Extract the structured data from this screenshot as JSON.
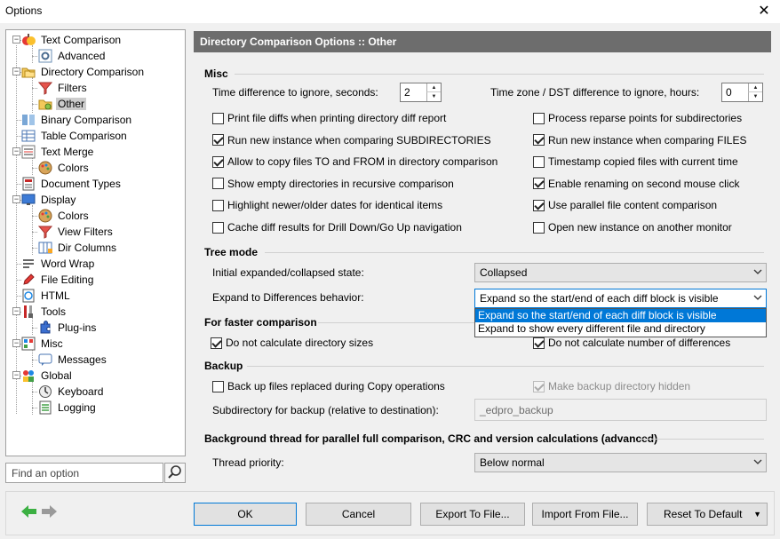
{
  "window": {
    "title": "Options",
    "close": "✕"
  },
  "tree": {
    "items": [
      {
        "label": "Text Comparison",
        "icon": "apple-text-comparison-icon"
      },
      {
        "label": "Advanced",
        "icon": "advanced-settings-icon"
      },
      {
        "label": "Directory Comparison",
        "icon": "folder-comparison-icon"
      },
      {
        "label": "Filters",
        "icon": "funnel-filter-icon"
      },
      {
        "label": "Other",
        "icon": "folder-gear-icon"
      },
      {
        "label": "Binary Comparison",
        "icon": "binary-comparison-icon"
      },
      {
        "label": "Table Comparison",
        "icon": "table-icon"
      },
      {
        "label": "Text Merge",
        "icon": "merge-icon"
      },
      {
        "label": "Colors",
        "icon": "palette-icon"
      },
      {
        "label": "Document Types",
        "icon": "document-types-icon"
      },
      {
        "label": "Display",
        "icon": "monitor-icon"
      },
      {
        "label": "Colors",
        "icon": "palette-icon"
      },
      {
        "label": "View Filters",
        "icon": "funnel-filter-icon"
      },
      {
        "label": "Dir Columns",
        "icon": "columns-icon"
      },
      {
        "label": "Word Wrap",
        "icon": "word-wrap-icon"
      },
      {
        "label": "File Editing",
        "icon": "pencil-icon"
      },
      {
        "label": "HTML",
        "icon": "html-icon"
      },
      {
        "label": "Tools",
        "icon": "tools-icon"
      },
      {
        "label": "Plug-ins",
        "icon": "puzzle-icon"
      },
      {
        "label": "Misc",
        "icon": "misc-icon"
      },
      {
        "label": "Messages",
        "icon": "message-icon"
      },
      {
        "label": "Global",
        "icon": "global-people-icon"
      },
      {
        "label": "Keyboard",
        "icon": "keyboard-icon"
      },
      {
        "label": "Logging",
        "icon": "logging-icon"
      }
    ],
    "selected": "Other"
  },
  "search": {
    "placeholder": "Find an option",
    "icon": "search-icon"
  },
  "panel": {
    "header": "Directory Comparison Options :: Other",
    "misc": {
      "title": "Misc",
      "time_diff_label": "Time difference to ignore, seconds:",
      "time_diff_value": "2",
      "tz_label": "Time zone / DST difference to ignore, hours:",
      "tz_value": "0",
      "left_checks": [
        {
          "label": "Print file diffs when printing directory diff report",
          "checked": false
        },
        {
          "label": "Run new instance when comparing SUBDIRECTORIES",
          "checked": true
        },
        {
          "label": "Allow to copy files TO and FROM in directory comparison",
          "checked": true
        },
        {
          "label": "Show empty directories in recursive comparison",
          "checked": false
        },
        {
          "label": "Highlight newer/older dates for identical items",
          "checked": false
        },
        {
          "label": "Cache diff results for Drill Down/Go Up navigation",
          "checked": false
        }
      ],
      "right_checks": [
        {
          "label": "Process reparse points for subdirectories",
          "checked": false
        },
        {
          "label": "Run new instance when comparing FILES",
          "checked": true
        },
        {
          "label": "Timestamp copied files with current time",
          "checked": false
        },
        {
          "label": "Enable renaming on second mouse click",
          "checked": true
        },
        {
          "label": "Use parallel file content comparison",
          "checked": true
        },
        {
          "label": "Open new instance on another monitor",
          "checked": false
        }
      ]
    },
    "tree_mode": {
      "title": "Tree mode",
      "initial_label": "Initial expanded/collapsed state:",
      "initial_value": "Collapsed",
      "expand_label": "Expand to Differences behavior:",
      "expand_value": "Expand so the start/end of each diff block is visible",
      "options": [
        "Expand so the start/end of each diff block is visible",
        "Expand to show every different file and directory"
      ]
    },
    "faster": {
      "title": "For faster comparison",
      "left": {
        "label": "Do not calculate directory sizes",
        "checked": true
      },
      "right": {
        "label": "Do not calculate number of differences",
        "checked": true
      }
    },
    "backup": {
      "title": "Backup",
      "backup_files": {
        "label": "Back up files replaced during Copy operations",
        "checked": false
      },
      "hidden": {
        "label": "Make backup directory hidden",
        "checked": true
      },
      "subdir_label": "Subdirectory for backup (relative to destination):",
      "subdir_value": "_edpro_backup"
    },
    "thread": {
      "title": "Background thread for parallel full comparison, CRC and version calculations (advanced)",
      "priority_label": "Thread priority:",
      "priority_value": "Below normal"
    }
  },
  "buttons": {
    "ok": "OK",
    "cancel": "Cancel",
    "export": "Export To File...",
    "import": "Import From File...",
    "reset": "Reset To Default"
  },
  "colors": {
    "header_bg": "#6d6d6d",
    "accent": "#0078d7",
    "back_arrow": "#3cb043",
    "forward_arrow": "#9a9a9a"
  }
}
